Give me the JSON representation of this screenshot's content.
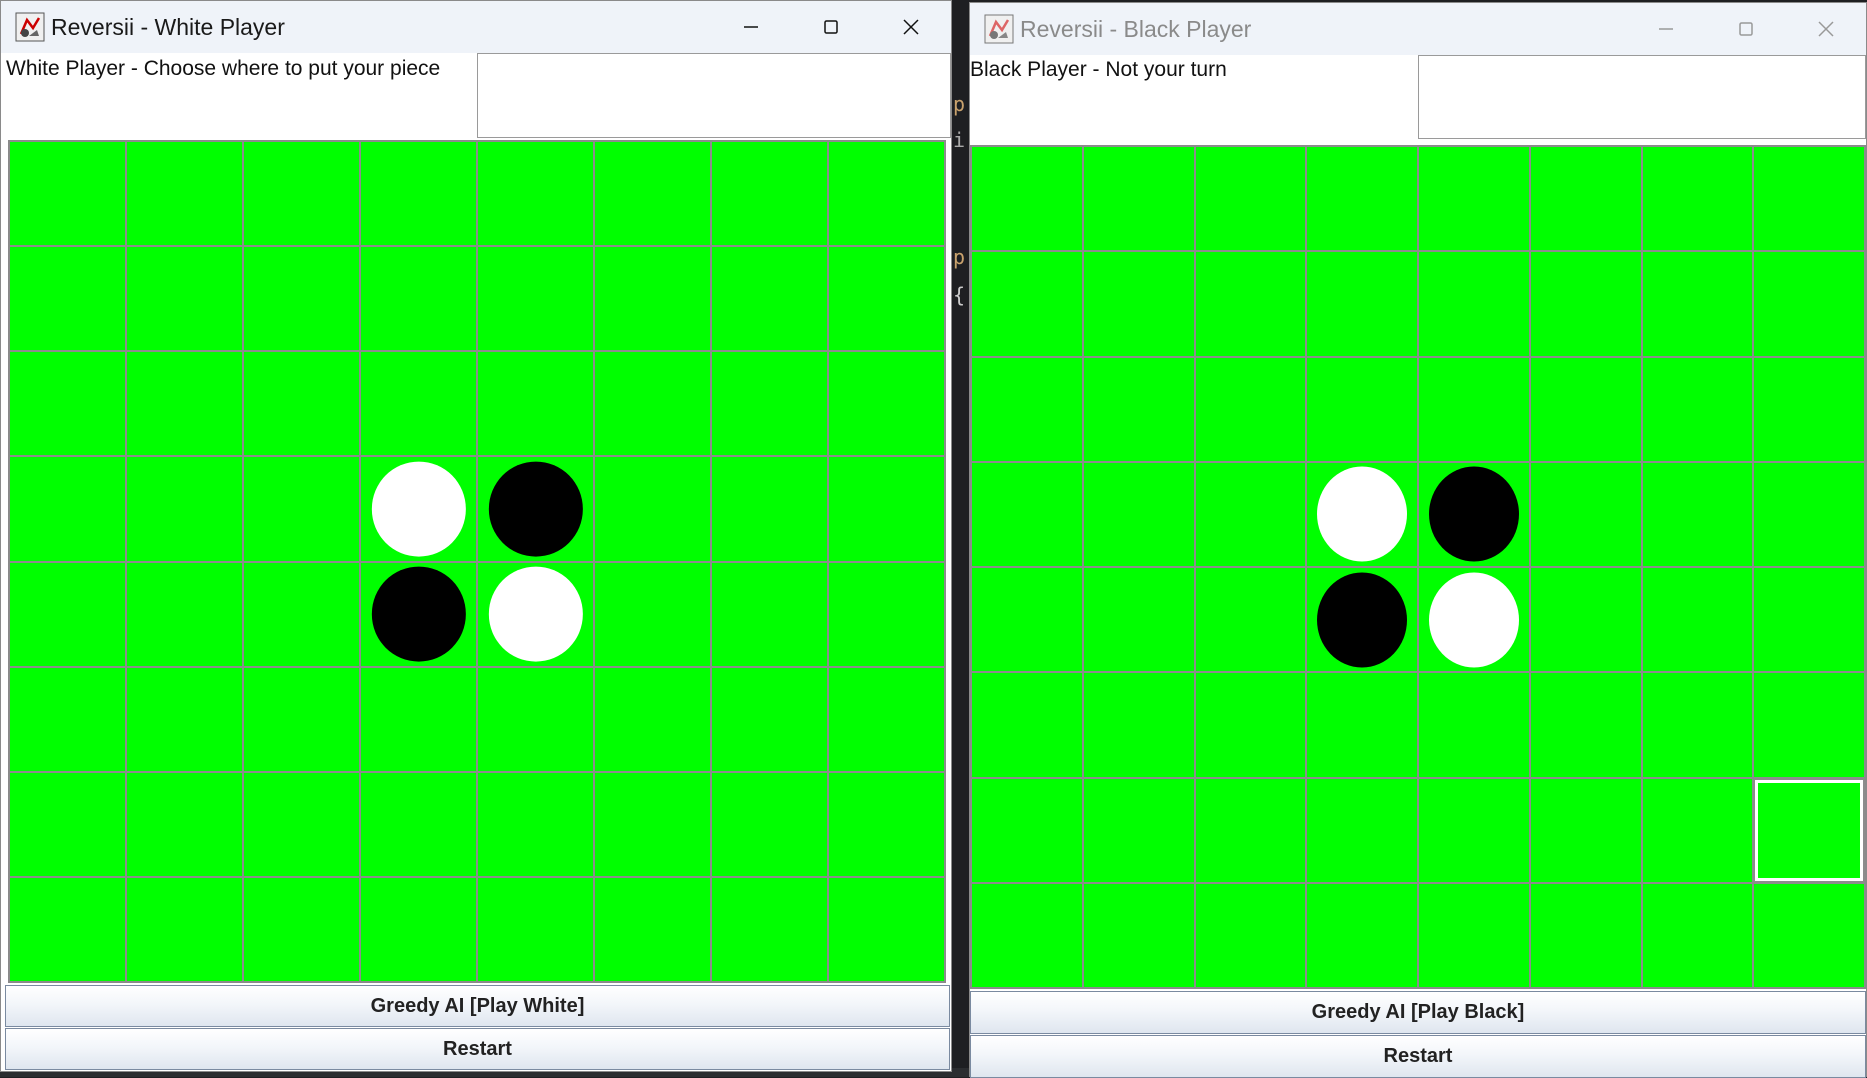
{
  "white_window": {
    "title": "Reversii - White Player",
    "status": "White Player - Choose where to put your piece",
    "message": "",
    "ai_button": "Greedy AI [Play White]",
    "restart_button": "Restart"
  },
  "black_window": {
    "title": "Reversii - Black Player",
    "status": "Black Player - Not your turn",
    "message": "",
    "ai_button": "Greedy AI [Play Black]",
    "restart_button": "Restart"
  },
  "board": {
    "rows": 8,
    "cols": 8,
    "cell_color": "#00ff00",
    "pieces": [
      {
        "row": 3,
        "col": 3,
        "color": "white"
      },
      {
        "row": 3,
        "col": 4,
        "color": "black"
      },
      {
        "row": 4,
        "col": 3,
        "color": "black"
      },
      {
        "row": 4,
        "col": 4,
        "color": "white"
      }
    ]
  },
  "black_board_focused_cell": {
    "row": 6,
    "col": 7
  },
  "icons": {
    "app": "java-app-icon",
    "minimize": "minimize-icon",
    "maximize": "maximize-icon",
    "close": "close-icon"
  }
}
